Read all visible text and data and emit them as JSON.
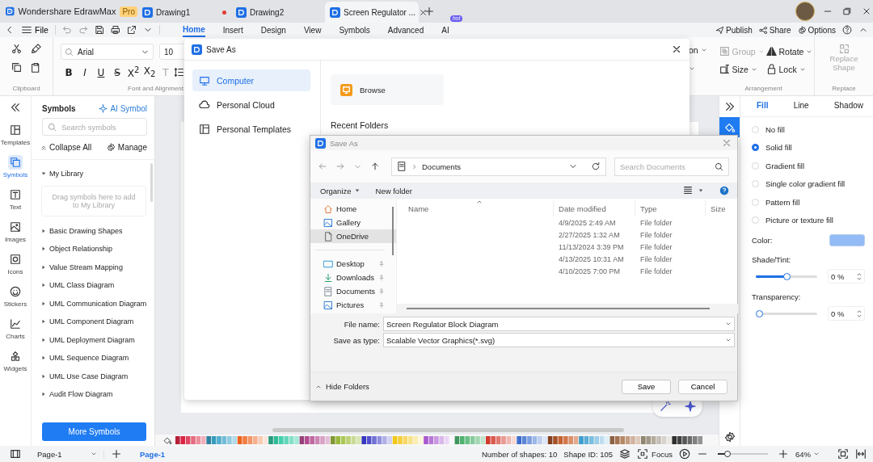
{
  "title_bar": {
    "app_name": "Wondershare EdrawMax",
    "badge": "Pro",
    "tabs": [
      {
        "label": "Drawing1",
        "selected": false,
        "unsaved": true
      },
      {
        "label": "Drawing2",
        "selected": false,
        "unsaved": false
      },
      {
        "label": "Screen Regulator ...",
        "selected": true,
        "unsaved": false
      }
    ]
  },
  "menu_bar": {
    "file": "File",
    "tabs": [
      {
        "label": "Home",
        "selected": true
      },
      {
        "label": "Insert",
        "selected": false
      },
      {
        "label": "Design",
        "selected": false
      },
      {
        "label": "View",
        "selected": false
      },
      {
        "label": "Symbols",
        "selected": false
      },
      {
        "label": "Advanced",
        "selected": false
      },
      {
        "label": "AI",
        "selected": false,
        "badge": "hot"
      }
    ],
    "actions": [
      "Publish",
      "Share",
      "Options"
    ]
  },
  "ribbon": {
    "clipboard_label": "Clipboard",
    "font": "Arial",
    "font_size": "10",
    "format_buttons": [
      {
        "label": "B",
        "kind": "bold"
      },
      {
        "label": "I",
        "kind": "italic"
      },
      {
        "label": "U",
        "kind": "underline"
      },
      {
        "label": "S",
        "kind": "strike"
      },
      {
        "label": "X$^{2}$",
        "kind": "plain"
      },
      {
        "label": "X$_{2}$",
        "kind": "plain"
      },
      {
        "label": "T",
        "kind": "muted"
      }
    ],
    "font_label": "Font and Alignment",
    "cut_label": "on",
    "arrange_buttons": [
      {
        "label": "Group",
        "disabled": true
      },
      {
        "label": "Rotate",
        "disabled": false
      },
      {
        "label": "Size",
        "disabled": false
      },
      {
        "label": "Lock",
        "disabled": false
      }
    ],
    "arrange_label": "Arrangement",
    "replace_button": {
      "label": "Replace Shape",
      "disabled": true
    },
    "replace_label": "Replace"
  },
  "left_rail": [
    {
      "label": "Templates",
      "selected": false
    },
    {
      "label": "Symbols",
      "selected": true
    },
    {
      "label": "Text",
      "selected": false
    },
    {
      "label": "Images",
      "selected": false
    },
    {
      "label": "Icons",
      "selected": false
    },
    {
      "label": "Stickers",
      "selected": false
    },
    {
      "label": "Charts",
      "selected": false
    },
    {
      "label": "Widgets",
      "selected": false
    }
  ],
  "symbols_panel": {
    "title": "Symbols",
    "ai_button": "AI Symbol",
    "search_placeholder": "Search symbols",
    "collapse_all": "Collapse All",
    "manage": "Manage",
    "my_library": {
      "label": "My Library",
      "expanded": true,
      "hint": "Drag symbols here to add to My Library"
    },
    "libraries": [
      {
        "label": "Basic Drawing Shapes",
        "expanded": false
      },
      {
        "label": "Object Relationship",
        "expanded": false
      },
      {
        "label": "Value Stream Mapping",
        "expanded": false
      },
      {
        "label": "UML Class Diagram",
        "expanded": false
      },
      {
        "label": "UML Communication Diagram",
        "expanded": false
      },
      {
        "label": "UML Component Diagram",
        "expanded": false
      },
      {
        "label": "UML Deployment Diagram",
        "expanded": false
      },
      {
        "label": "UML Sequence Diagram",
        "expanded": false
      },
      {
        "label": "UML Use Case Diagram",
        "expanded": false
      },
      {
        "label": "Audit Flow Diagram",
        "expanded": false
      }
    ],
    "more_button": "More Symbols"
  },
  "edraw_dialog": {
    "title": "Save As",
    "locations": [
      {
        "label": "Computer",
        "selected": true
      },
      {
        "label": "Personal Cloud",
        "selected": false
      },
      {
        "label": "Personal Templates",
        "selected": false
      }
    ],
    "browse": "Browse",
    "recent_label": "Recent Folders"
  },
  "file_dialog": {
    "title": "Save As",
    "path": "Documents",
    "search_placeholder": "Search Documents",
    "organize": "Organize",
    "new_folder": "New folder",
    "nav": [
      {
        "items": [
          {
            "label": "Home",
            "kind": "home",
            "selected": false,
            "pinned": false
          },
          {
            "label": "Gallery",
            "kind": "gallery",
            "selected": false,
            "pinned": false
          },
          {
            "label": "OneDrive",
            "kind": "file",
            "selected": true,
            "pinned": false
          }
        ]
      },
      {
        "items": [
          {
            "label": "Desktop",
            "kind": "desktop",
            "selected": false,
            "pinned": true
          },
          {
            "label": "Downloads",
            "kind": "download",
            "selected": false,
            "pinned": true
          },
          {
            "label": "Documents",
            "kind": "documents",
            "selected": false,
            "pinned": true
          },
          {
            "label": "Pictures",
            "kind": "pictures",
            "selected": false,
            "pinned": true
          }
        ]
      }
    ],
    "columns": [
      "Name",
      "Date modified",
      "Type",
      "Size"
    ],
    "rows": [
      {
        "date_modified": "4/9/2025 2:49 AM",
        "type": "File folder"
      },
      {
        "date_modified": "2/27/2025 1:32 AM",
        "type": "File folder"
      },
      {
        "date_modified": "11/13/2024 3:39 PM",
        "type": "File folder"
      },
      {
        "date_modified": "4/13/2025 10:31 AM",
        "type": "File folder"
      },
      {
        "date_modified": "4/10/2025 7:00 PM",
        "type": "File folder"
      }
    ],
    "file_name_label": "File name:",
    "file_name": "Screen Regulator Block Diagram",
    "save_type_label": "Save as type:",
    "save_type": "Scalable Vector Graphics(*.svg)",
    "hide_folders": "Hide Folders",
    "buttons": [
      "Save",
      "Cancel"
    ]
  },
  "right_panel": {
    "tabs": [
      {
        "label": "Fill",
        "selected": true
      },
      {
        "label": "Line",
        "selected": false
      },
      {
        "label": "Shadow",
        "selected": false
      }
    ],
    "fill_options": [
      {
        "label": "No fill",
        "selected": false
      },
      {
        "label": "Solid fill",
        "selected": true
      },
      {
        "label": "Gradient fill",
        "selected": false
      },
      {
        "label": "Single color gradient fill",
        "selected": false
      },
      {
        "label": "Pattern fill",
        "selected": false
      },
      {
        "label": "Picture or texture fill",
        "selected": false
      }
    ],
    "color": {
      "label": "Color:",
      "color": "#93bbf5"
    },
    "shade": {
      "label": "Shade/Tint:",
      "level": 0.5,
      "value": "0 %"
    },
    "transparency": {
      "label": "Transparency:",
      "level": 0,
      "value": "0 %"
    }
  },
  "status_bar": {
    "page_select": "Page-1",
    "pages": [
      {
        "label": "Page-1",
        "selected": true
      }
    ],
    "shape_count": "Number of shapes: 10",
    "shape_id": "Shape ID: 105",
    "focus": "Focus",
    "zoom": {
      "level": 0.15,
      "value": "64%"
    }
  }
}
